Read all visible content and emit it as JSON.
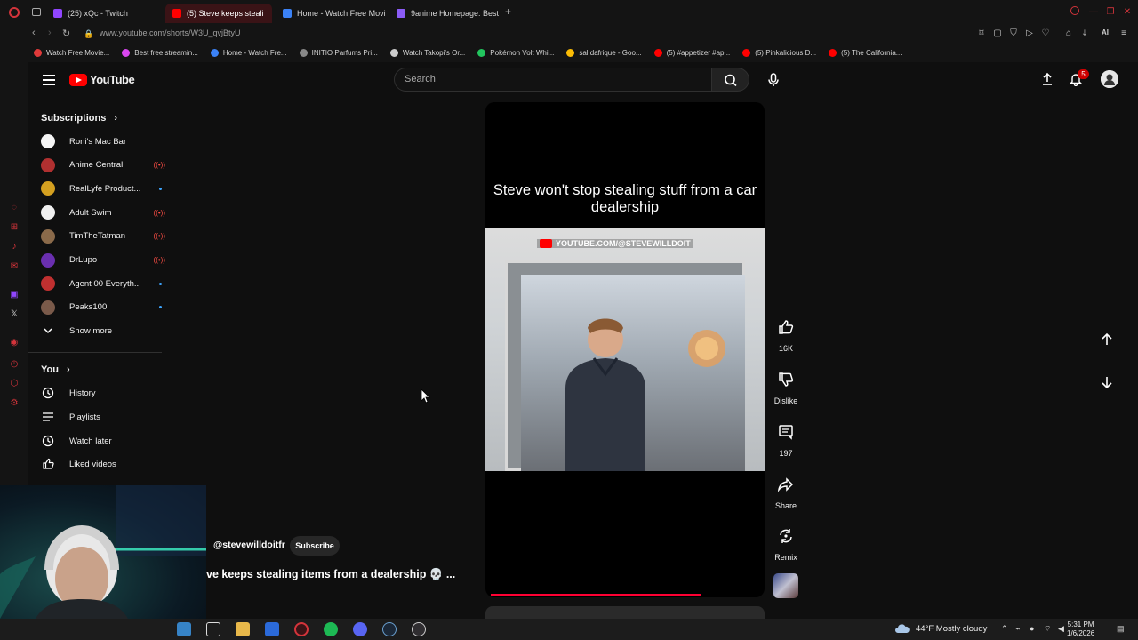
{
  "browser": {
    "tabs": [
      {
        "label": "(25) xQc - Twitch",
        "color": "#9146ff",
        "active": false
      },
      {
        "label": "(5) Steve keeps steali",
        "color": "#ff0000",
        "active": true
      },
      {
        "label": "Home - Watch Free Movie",
        "color": "#3b82f6",
        "active": false
      },
      {
        "label": "9anime Homepage: Best f",
        "color": "#8b5cf6",
        "active": false
      }
    ],
    "url": "www.youtube.com/shorts/W3U_qvjBtyU",
    "bookmarks": [
      {
        "label": "Watch Free Movie...",
        "color": "#e03a3a"
      },
      {
        "label": "Best free streamin...",
        "color": "#d946ef"
      },
      {
        "label": "Home - Watch Fre...",
        "color": "#3b82f6"
      },
      {
        "label": "INITIO Parfums Pri...",
        "color": "#888888"
      },
      {
        "label": "Watch Takopi's Or...",
        "color": "#cccccc"
      },
      {
        "label": "Pokémon Volt Whi...",
        "color": "#22c55e"
      },
      {
        "label": "sal dafrique - Goo...",
        "color": "#fbbc05"
      },
      {
        "label": "(5) #appetizer #ap...",
        "color": "#ff0000"
      },
      {
        "label": "(5) Pinkalicious D...",
        "color": "#ff0000"
      },
      {
        "label": "(5) The California...",
        "color": "#ff0000"
      }
    ]
  },
  "youtube": {
    "logo": "YouTube",
    "search_placeholder": "Search",
    "notifications": "5",
    "sidebar": {
      "subscriptions_title": "Subscriptions",
      "subscriptions": [
        {
          "name": "Roni's Mac Bar",
          "color": "#f5f5f5",
          "status": ""
        },
        {
          "name": "Anime Central",
          "color": "#b03030",
          "status": "live"
        },
        {
          "name": "RealLyfe Product...",
          "color": "#d4a020",
          "status": "new"
        },
        {
          "name": "Adult Swim",
          "color": "#f0f0f0",
          "status": "live"
        },
        {
          "name": "TimTheTatman",
          "color": "#8a6a4a",
          "status": "live"
        },
        {
          "name": "DrLupo",
          "color": "#6a2fb0",
          "status": "live"
        },
        {
          "name": "Agent 00 Everyth...",
          "color": "#c03030",
          "status": "new"
        },
        {
          "name": "Peaks100",
          "color": "#7a5a4a",
          "status": "new"
        }
      ],
      "show_more": "Show more",
      "you_title": "You",
      "you_items": [
        {
          "label": "History",
          "icon": "history-icon"
        },
        {
          "label": "Playlists",
          "icon": "playlists-icon"
        },
        {
          "label": "Watch later",
          "icon": "watch-later-icon"
        },
        {
          "label": "Liked videos",
          "icon": "liked-icon"
        }
      ]
    },
    "short": {
      "caption": "Steve won't stop stealing stuff from a car dealership",
      "watermark": "YOUTUBE.COM/@STEVEWILLDOIT",
      "channel": "@stevewilldoitfr",
      "subscribe": "Subscribe",
      "title": "ve keeps stealing items from a dealership 💀 ...",
      "progress": 0.77
    },
    "actions": {
      "likes": "16K",
      "dislike": "Dislike",
      "comments": "197",
      "share": "Share",
      "remix": "Remix"
    }
  },
  "taskbar": {
    "weather": "44°F  Mostly cloudy",
    "time": "5:31 PM",
    "date": "1/6/2026"
  }
}
